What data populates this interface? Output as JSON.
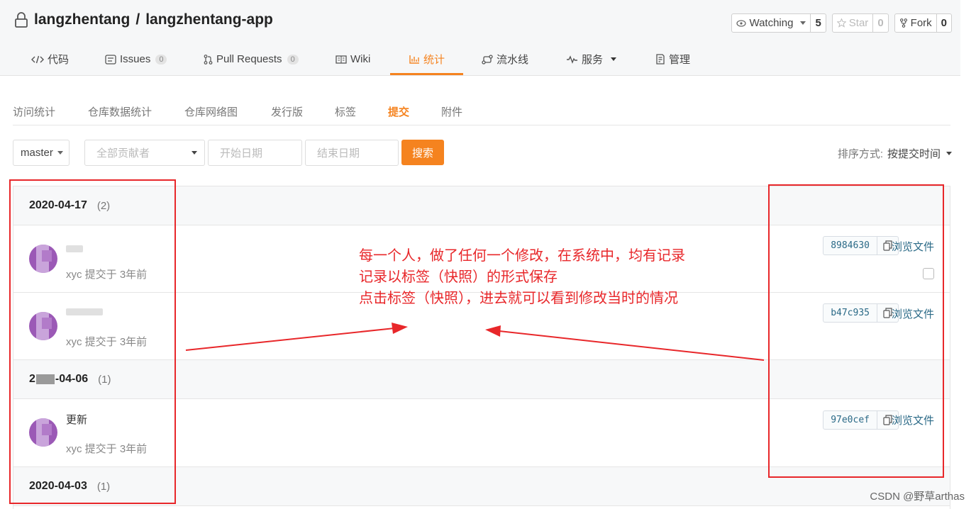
{
  "repo": {
    "owner": "langzhentang",
    "separator": "/",
    "name": "langzhentang-app"
  },
  "actions": [
    {
      "label": "Watching",
      "count": "5",
      "icon": "eye-icon"
    },
    {
      "label": "Star",
      "count": "0",
      "icon": "star-icon"
    },
    {
      "label": "Fork",
      "count": "0",
      "icon": "fork-icon"
    }
  ],
  "tabs": [
    {
      "label": "代码",
      "icon": "code-icon"
    },
    {
      "label": "Issues",
      "badge": "0",
      "icon": "issues-icon"
    },
    {
      "label": "Pull Requests",
      "badge": "0",
      "icon": "pull-request-icon"
    },
    {
      "label": "Wiki",
      "icon": "book-icon"
    },
    {
      "label": "统计",
      "icon": "bar-chart-icon",
      "active": true
    },
    {
      "label": "流水线",
      "icon": "pipeline-icon"
    },
    {
      "label": "服务",
      "icon": "pulse-icon"
    },
    {
      "label": "管理",
      "icon": "settings-doc-icon"
    }
  ],
  "subnav": [
    "访问统计",
    "仓库数据统计",
    "仓库网络图",
    "发行版",
    "标签",
    "提交",
    "附件"
  ],
  "subnav_active": "提交",
  "filters": {
    "branch": "master",
    "contributors_placeholder": "全部贡献者",
    "start_date_placeholder": "开始日期",
    "end_date_placeholder": "结束日期",
    "search_label": "搜索",
    "sort_label": "排序方式:",
    "sort_value": "按提交时间"
  },
  "groups": [
    {
      "date": "2020-04-17",
      "count": "(2)"
    },
    {
      "date": "-04-06",
      "date_prefix": "2",
      "count": "(1)"
    },
    {
      "date": "2020-04-03",
      "count": "(1)"
    }
  ],
  "commits": [
    {
      "message": "",
      "meta": "xyc 提交于 3年前",
      "sha": "8984630",
      "browse": "浏览文件"
    },
    {
      "message": "",
      "meta": "xyc 提交于 3年前",
      "sha": "b47c935",
      "browse": "浏览文件"
    },
    {
      "message": "更新",
      "meta": "xyc 提交于 3年前",
      "sha": "97e0cef",
      "browse": "浏览文件"
    }
  ],
  "annotation": {
    "line1": "每一个人，做了任何一个修改，在系统中，均有记录",
    "line2": "记录以标签（快照）的形式保存",
    "line3": "点击标签（快照），进去就可以看到修改当时的情况"
  },
  "colors": {
    "accent": "#f5831f",
    "annotation": "#e8272a",
    "link": "#2b6a87"
  },
  "watermark": "CSDN @野草arthas"
}
